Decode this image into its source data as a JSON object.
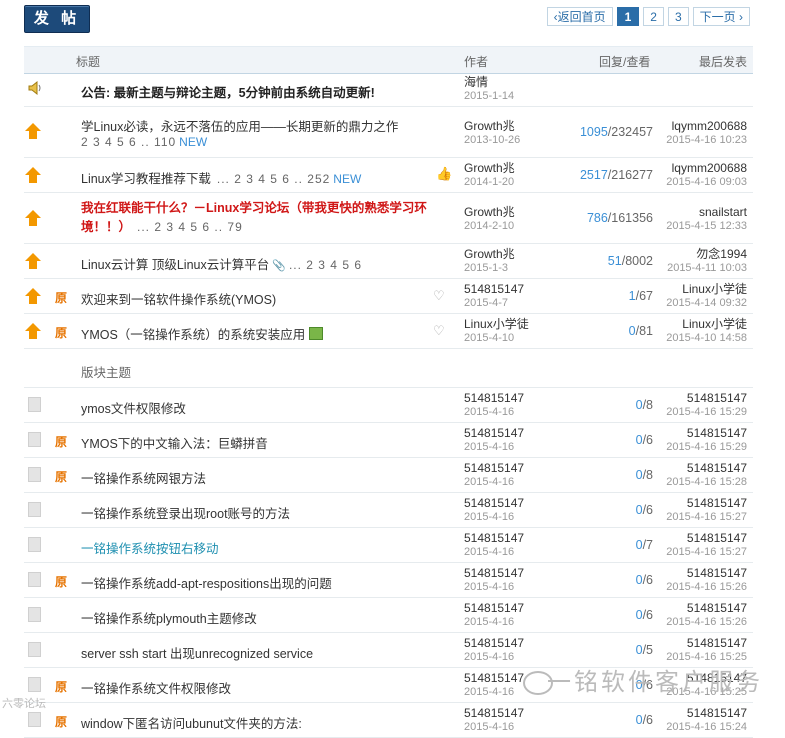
{
  "post_button": "发 帖",
  "pager": {
    "prev": "返回首页",
    "pages": [
      "1",
      "2",
      "3"
    ],
    "next": "下一页"
  },
  "header": {
    "title": "标题",
    "author": "作者",
    "stats": "回复/查看",
    "last": "最后发表"
  },
  "threads": [
    {
      "title": "公告: 最新主题与辩论主题，5分钟前由系统自动更新!",
      "author": "海情",
      "date": "2015-1-14",
      "stats": "",
      "replies": "",
      "views": "",
      "last_user": "",
      "last_date": ""
    },
    {
      "title": "学Linux必读，永远不落伍的应用——长期更新的鼎力之作",
      "pages": "2 3 4 5 6 .. 110",
      "new": "NEW",
      "author": "Growth兆",
      "date": "2013-10-26",
      "replies": "1095",
      "views": "232457",
      "last_user": "lqymm200688",
      "last_date": "2015-4-16 10:23"
    },
    {
      "title": "Linux学习教程推荐下载",
      "pages": "... 2 3 4 5 6 .. 252",
      "new": "NEW",
      "author": "Growth兆",
      "date": "2014-1-20",
      "replies": "2517",
      "views": "216277",
      "last_user": "lqymm200688",
      "last_date": "2015-4-16 09:03"
    },
    {
      "title": "我在红联能干什么？－Linux学习论坛（带我更快的熟悉学习环境！！）",
      "pages": "... 2 3 4 5 6 .. 79",
      "author": "Growth兆",
      "date": "2014-2-10",
      "replies": "786",
      "views": "161356",
      "last_user": "snailstart",
      "last_date": "2015-4-15 12:33"
    },
    {
      "title": "Linux云计算 顶级Linux云计算平台",
      "pages": "... 2 3 4 5 6",
      "author": "Growth兆",
      "date": "2015-1-3",
      "replies": "51",
      "views": "8002",
      "last_user": "勿念1994",
      "last_date": "2015-4-11 10:03"
    },
    {
      "orig": "原",
      "title": "欢迎来到一铭软件操作系统(YMOS)",
      "author": "514815147",
      "date": "2015-4-7",
      "replies": "1",
      "views": "67",
      "last_user": "Linux小学徒",
      "last_date": "2015-4-14 09:32"
    },
    {
      "orig": "原",
      "title": "YMOS（一铭操作系统）的系统安装应用",
      "author": "Linux小学徒",
      "date": "2015-4-10",
      "replies": "0",
      "views": "81",
      "last_user": "Linux小学徒",
      "last_date": "2015-4-10 14:58"
    }
  ],
  "section_label": "版块主题",
  "normal_threads": [
    {
      "orig": "",
      "title": "ymos文件权限修改",
      "author": "514815147",
      "date": "2015-4-16",
      "replies": "0",
      "views": "8",
      "last_user": "514815147",
      "last_date": "2015-4-16 15:29"
    },
    {
      "orig": "原",
      "title": "YMOS下的中文输入法：巨蟒拼音",
      "author": "514815147",
      "date": "2015-4-16",
      "replies": "0",
      "views": "6",
      "last_user": "514815147",
      "last_date": "2015-4-16 15:29"
    },
    {
      "orig": "原",
      "title": "一铭操作系统网银方法",
      "author": "514815147",
      "date": "2015-4-16",
      "replies": "0",
      "views": "8",
      "last_user": "514815147",
      "last_date": "2015-4-16 15:28"
    },
    {
      "orig": "",
      "title": "一铭操作系统登录出现root账号的方法",
      "author": "514815147",
      "date": "2015-4-16",
      "replies": "0",
      "views": "6",
      "last_user": "514815147",
      "last_date": "2015-4-16 15:27"
    },
    {
      "orig": "",
      "title": "一铭操作系统按钮右移动",
      "author": "514815147",
      "date": "2015-4-16",
      "replies": "0",
      "views": "7",
      "last_user": "514815147",
      "last_date": "2015-4-16 15:27"
    },
    {
      "orig": "原",
      "title": "一铭操作系统add-apt-respositions出现的问题",
      "author": "514815147",
      "date": "2015-4-16",
      "replies": "0",
      "views": "6",
      "last_user": "514815147",
      "last_date": "2015-4-16 15:26"
    },
    {
      "orig": "",
      "title": "一铭操作系统plymouth主题修改",
      "author": "514815147",
      "date": "2015-4-16",
      "replies": "0",
      "views": "6",
      "last_user": "514815147",
      "last_date": "2015-4-16 15:26"
    },
    {
      "orig": "",
      "title": "server ssh start 出现unrecognized service",
      "author": "514815147",
      "date": "2015-4-16",
      "replies": "0",
      "views": "5",
      "last_user": "514815147",
      "last_date": "2015-4-16 15:25"
    },
    {
      "orig": "原",
      "title": "一铭操作系统文件权限修改",
      "author": "514815147",
      "date": "2015-4-16",
      "replies": "0",
      "views": "6",
      "last_user": "514815147",
      "last_date": "2015-4-16 15:25"
    },
    {
      "orig": "原",
      "title": "window下匿名访问ubunut文件夹的方法:",
      "author": "514815147",
      "date": "2015-4-16",
      "replies": "0",
      "views": "6",
      "last_user": "514815147",
      "last_date": "2015-4-16 15:24"
    }
  ],
  "watermark": {
    "right": "一铭软件客户服务",
    "left": "六零论坛"
  },
  "colors": {
    "accent": "#2a6da8",
    "sticky_arrow": "#f39800",
    "red_title": "#d01717",
    "orig": "#e67300"
  }
}
